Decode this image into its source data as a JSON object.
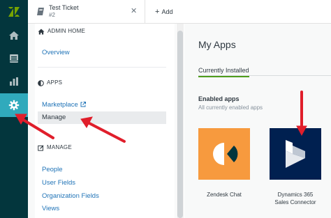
{
  "topbar": {
    "ticket_tab": {
      "title": "Test Ticket",
      "number": "#2",
      "close_icon": "close-icon"
    },
    "add_label": "Add"
  },
  "rail": {
    "items": [
      {
        "icon": "zendesk-logo"
      },
      {
        "icon": "home-icon"
      },
      {
        "icon": "views-icon"
      },
      {
        "icon": "reporting-icon"
      },
      {
        "icon": "gear-icon",
        "active": true
      }
    ]
  },
  "sidebar": {
    "admin_home": {
      "heading": "ADMIN HOME",
      "links": [
        "Overview"
      ]
    },
    "apps": {
      "heading": "APPS",
      "links": [
        "Marketplace",
        "Manage"
      ],
      "active": "Manage"
    },
    "manage": {
      "heading": "MANAGE",
      "links": [
        "People",
        "User Fields",
        "Organization Fields",
        "Views"
      ]
    }
  },
  "main": {
    "title": "My Apps",
    "tab_installed": "Currently Installed",
    "enabled_title": "Enabled apps",
    "enabled_subtitle": "All currently enabled apps",
    "apps": [
      {
        "name": "Zendesk Chat",
        "tile_color": "#f79a3e"
      },
      {
        "name": "Dynamics 365 Sales Connector",
        "name_line1": "Dynamics 365",
        "name_line2": "Sales Connector",
        "tile_color": "#002050"
      }
    ]
  },
  "colors": {
    "rail_bg": "#03363d",
    "rail_active": "#30aabc",
    "link": "#1f73b7",
    "tab_underline": "#4f9c1c",
    "annotation_arrow": "#e01e2b"
  }
}
